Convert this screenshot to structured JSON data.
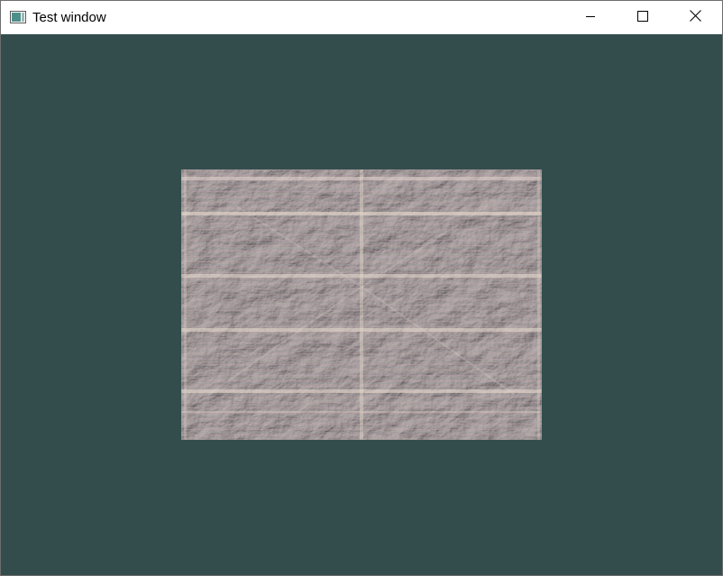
{
  "window": {
    "title": "Test window",
    "icon": "app-window-icon"
  },
  "caption_buttons": {
    "minimize_icon": "minimize-icon",
    "maximize_icon": "maximize-icon",
    "close_icon": "close-icon"
  },
  "client": {
    "clear_color": "#334d4d",
    "texture": "rock-texture-quad"
  }
}
